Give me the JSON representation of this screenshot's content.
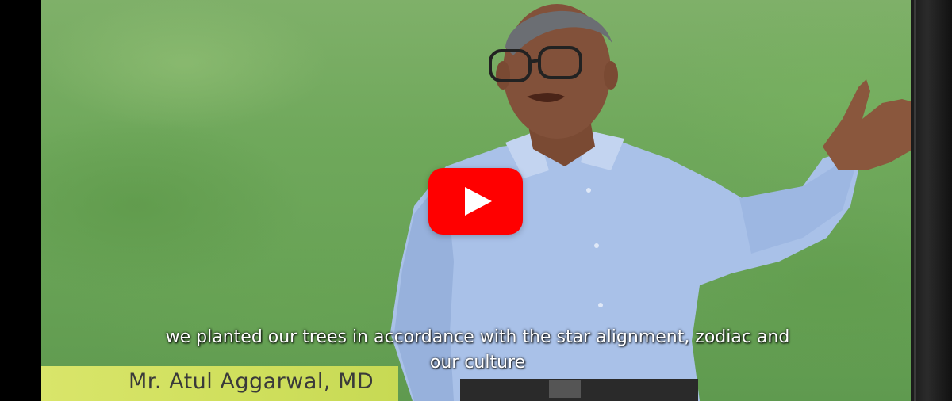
{
  "video": {
    "subtitle_line1": "we planted our trees in accordance with the star alignment, zodiac and",
    "subtitle_line2": "our culture",
    "lower_third_name": "Mr. Atul Aggarwal, MD"
  },
  "play_button": {
    "icon": "play-icon",
    "color": "#ff0000"
  },
  "colors": {
    "lower_third_bar": "#d2e05e",
    "subtitle_text": "#ffffff",
    "background_grass": "#6aa457"
  }
}
